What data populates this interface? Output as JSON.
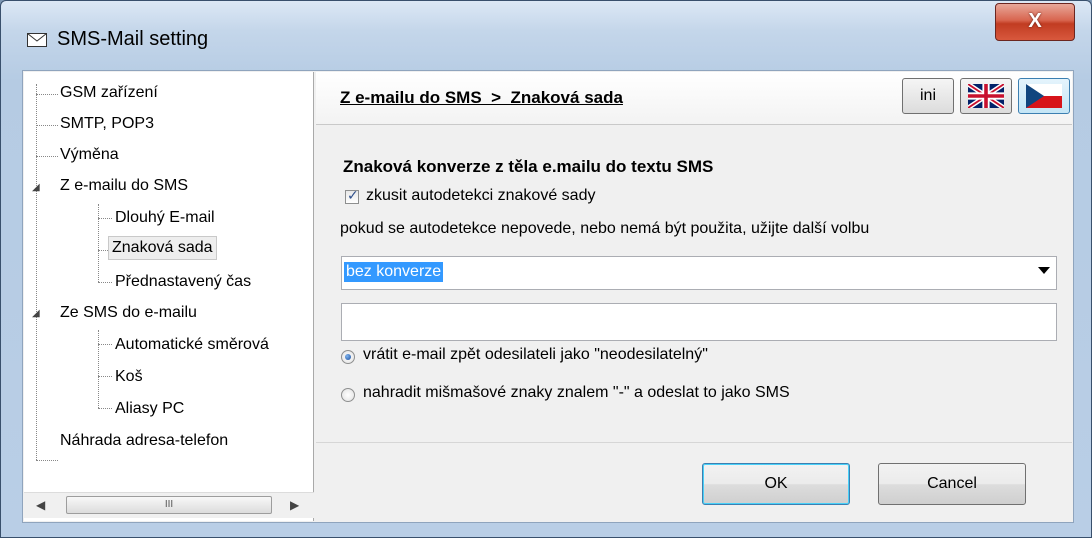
{
  "window": {
    "title": "SMS-Mail setting",
    "close_label": "X"
  },
  "tree": {
    "items": [
      {
        "label": "GSM zařízení"
      },
      {
        "label": "SMTP, POP3"
      },
      {
        "label": "Výměna"
      },
      {
        "label": "Z e-mailu do SMS"
      },
      {
        "label": "Dlouhý E-mail"
      },
      {
        "label": "Znaková sada"
      },
      {
        "label": "Přednastavený čas"
      },
      {
        "label": "Ze SMS do e-mailu"
      },
      {
        "label": "Automatické směrová"
      },
      {
        "label": "Koš"
      },
      {
        "label": "Aliasy PC"
      },
      {
        "label": "Náhrada adresa-telefon"
      }
    ],
    "scroll_thumb_glyph": "III"
  },
  "header": {
    "breadcrumb": "Z e-mailu do SMS  >  Znaková sada",
    "ini_label": "ini",
    "lang_uk_icon": "uk-flag-icon",
    "lang_cz_icon": "czech-flag-icon"
  },
  "content": {
    "section_title": "Znaková konverze z těla e.mailu do textu SMS",
    "autodetect_label": "zkusit autodetekci znakové sady",
    "autodetect_checked": true,
    "hint": "pokud se autodetekce nepovede, nebo nemá být použita, užijte další volbu",
    "conversion_selected": "bez konverze",
    "custom_text_value": "",
    "radio_return": "vrátit e-mail zpět odesilateli jako \"neodesilatelný\"",
    "radio_replace": "nahradit mišmašové znaky znalem \"-\" a odeslat to jako SMS",
    "selected_radio": "return"
  },
  "buttons": {
    "ok": "OK",
    "cancel": "Cancel"
  },
  "colors": {
    "selection": "#3399ff",
    "close_red": "#c13c22",
    "titlebar": "#c4d6ea"
  }
}
